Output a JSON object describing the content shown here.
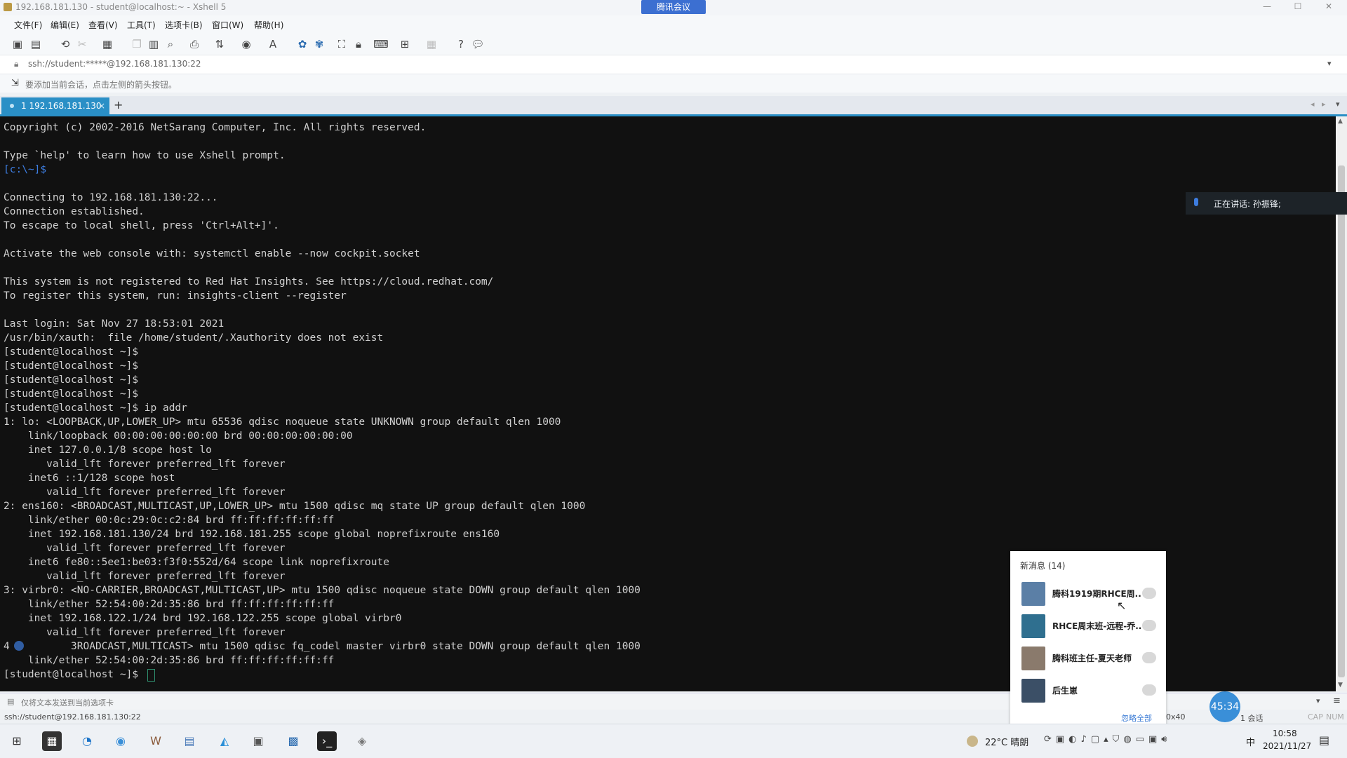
{
  "window": {
    "title": "192.168.181.130 - student@localhost:~ - Xshell 5",
    "meeting_badge": "腾讯会议"
  },
  "menu": [
    "文件(F)",
    "编辑(E)",
    "查看(V)",
    "工具(T)",
    "选项卡(B)",
    "窗口(W)",
    "帮助(H)"
  ],
  "toolbar": {
    "icons": [
      "new-session-icon",
      "open-folder-icon",
      "reconnect-icon",
      "disconnect-icon",
      "properties-icon",
      "copy-icon",
      "paste-icon",
      "find-icon",
      "print-icon",
      "transfer-icon",
      "globe-icon",
      "font-icon",
      "xftp-icon",
      "xmanager-icon",
      "fullscreen-icon",
      "lock-icon",
      "keyboard-icon",
      "add-icon",
      "layout-icon",
      "help-icon",
      "chat-icon"
    ]
  },
  "address": {
    "value": "ssh://student:*****@192.168.181.130:22"
  },
  "hint": {
    "text": "要添加当前会话，点击左侧的箭头按钮。"
  },
  "tabs": {
    "session": "1 192.168.181.130",
    "close": "×",
    "add": "+"
  },
  "terminal": {
    "lines": [
      "Copyright (c) 2002-2016 NetSarang Computer, Inc. All rights reserved.",
      "",
      "Type `help' to learn how to use Xshell prompt.",
      "[c:\\~]$",
      "",
      "Connecting to 192.168.181.130:22...",
      "Connection established.",
      "To escape to local shell, press 'Ctrl+Alt+]'.",
      "",
      "Activate the web console with: systemctl enable --now cockpit.socket",
      "",
      "This system is not registered to Red Hat Insights. See https://cloud.redhat.com/",
      "To register this system, run: insights-client --register",
      "",
      "Last login: Sat Nov 27 18:53:01 2021",
      "/usr/bin/xauth:  file /home/student/.Xauthority does not exist",
      "[student@localhost ~]$",
      "[student@localhost ~]$",
      "[student@localhost ~]$",
      "[student@localhost ~]$",
      "[student@localhost ~]$ ip addr",
      "1: lo: <LOOPBACK,UP,LOWER_UP> mtu 65536 qdisc noqueue state UNKNOWN group default qlen 1000",
      "    link/loopback 00:00:00:00:00:00 brd 00:00:00:00:00:00",
      "    inet 127.0.0.1/8 scope host lo",
      "       valid_lft forever preferred_lft forever",
      "    inet6 ::1/128 scope host",
      "       valid_lft forever preferred_lft forever",
      "2: ens160: <BROADCAST,MULTICAST,UP,LOWER_UP> mtu 1500 qdisc mq state UP group default qlen 1000",
      "    link/ether 00:0c:29:0c:c2:84 brd ff:ff:ff:ff:ff:ff",
      "    inet 192.168.181.130/24 brd 192.168.181.255 scope global noprefixroute ens160",
      "       valid_lft forever preferred_lft forever",
      "    inet6 fe80::5ee1:be03:f3f0:552d/64 scope link noprefixroute",
      "       valid_lft forever preferred_lft forever",
      "3: virbr0: <NO-CARRIER,BROADCAST,MULTICAST,UP> mtu 1500 qdisc noqueue state DOWN group default qlen 1000",
      "    link/ether 52:54:00:2d:35:86 brd ff:ff:ff:ff:ff:ff",
      "    inet 192.168.122.1/24 brd 192.168.122.255 scope global virbr0",
      "       valid_lft forever preferred_lft forever",
      "4          3ROADCAST,MULTICAST> mtu 1500 qdisc fq_codel master virbr0 state DOWN group default qlen 1000",
      "    link/ether 52:54:00:2d:35:86 brd ff:ff:ff:ff:ff:ff",
      "[student@localhost ~]$ "
    ]
  },
  "speaking_overlay": {
    "text": "正在讲话: 孙振锋;"
  },
  "send_bar": {
    "text": "仅将文本发送到当前选项卡"
  },
  "status_bar": {
    "address": "ssh://student@192.168.181.130:22",
    "size": "0x40",
    "sessions": "1 会话",
    "cap": "CAP",
    "num": "NUM"
  },
  "notifications": {
    "header": "新消息 (14)",
    "items": [
      {
        "name": "腾科1919期RHCE周...",
        "avatar_color": "#5b7fa6"
      },
      {
        "name": "RHCE周末班-远程-乔...",
        "avatar_color": "#2f6f8f"
      },
      {
        "name": "腾科班主任-夏天老师",
        "avatar_color": "#8a7a6c"
      },
      {
        "name": "后生崽",
        "avatar_color": "#3b4f66"
      }
    ],
    "ignore_all": "忽略全部"
  },
  "timer": "45:34",
  "taskbar": {
    "icons": [
      "windows-start-icon",
      "app-icon",
      "edge-icon",
      "chrome-icon",
      "wps-icon",
      "file-explorer-icon",
      "meeting-icon",
      "document-icon",
      "xshell-icon",
      "terminal-icon",
      "vmware-icon"
    ],
    "weather": "22°C 晴朗",
    "ime": "中",
    "time": "10:58",
    "date": "2021/11/27"
  },
  "colors": {
    "accent": "#2a8fc6",
    "terminal_bg": "#111111",
    "terminal_fg": "#d0d0d0",
    "prompt": "#3d7de0"
  }
}
